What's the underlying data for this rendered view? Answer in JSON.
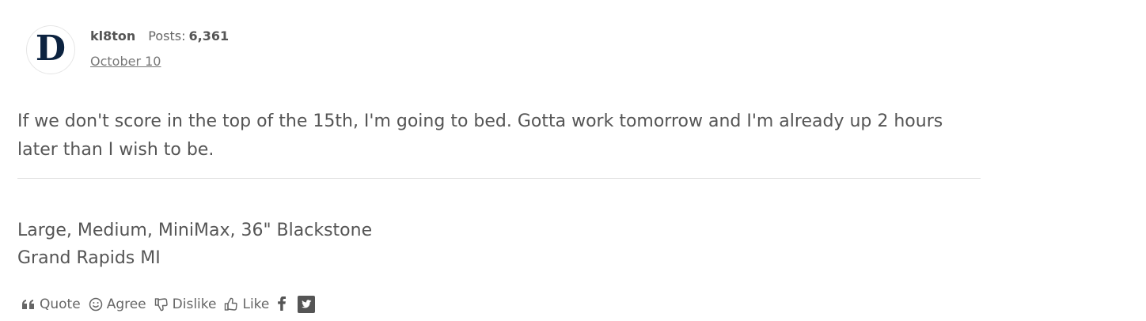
{
  "post": {
    "author": "kl8ton",
    "posts_label": "Posts:",
    "posts_count": "6,361",
    "date": "October 10",
    "avatar_letter": "D",
    "body": "If we don't score in the top of the 15th, I'm going to bed. Gotta work tomorrow and I'm already up 2 hours later than I wish to be.",
    "signature": {
      "line1": "Large, Medium, MiniMax, 36\" Blackstone",
      "line2": "Grand Rapids MI"
    }
  },
  "actions": {
    "quote": "Quote",
    "agree": "Agree",
    "dislike": "Dislike",
    "like": "Like"
  },
  "icons": {
    "quote": "quote-icon",
    "agree": "smiley-icon",
    "dislike": "thumbs-down-icon",
    "like": "thumbs-up-icon",
    "facebook": "facebook-icon",
    "twitter": "twitter-icon"
  },
  "colors": {
    "text": "#555555",
    "avatar_navy": "#0c2340",
    "divider": "#dddddd"
  }
}
